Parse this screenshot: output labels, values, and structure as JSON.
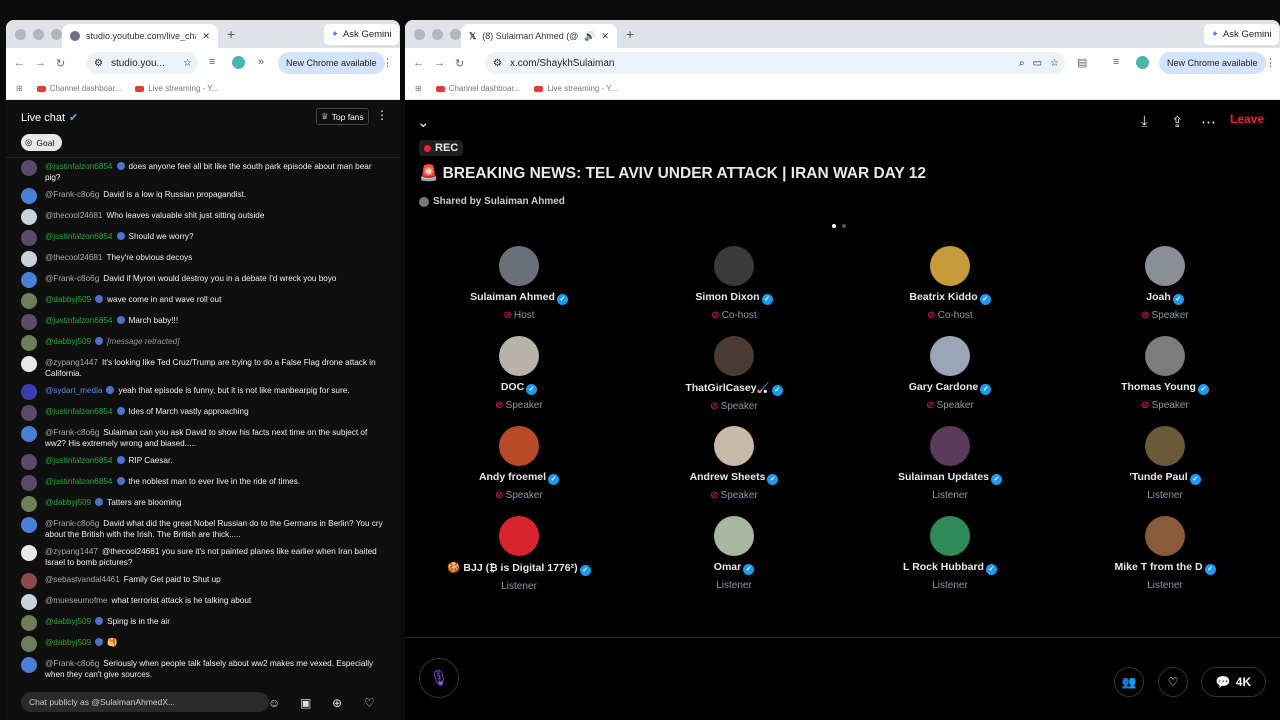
{
  "left_window": {
    "tab_title": "studio.youtube.com/live_cha",
    "ask_gemini": "Ask Gemini",
    "url": "studio.you...",
    "new_chrome": "New Chrome available",
    "bookmarks": [
      "Channel dashboar...",
      "Live streaming - Y..."
    ],
    "chat": {
      "title": "Live chat",
      "top_fans": "Top fans",
      "goal": "Goal",
      "input_placeholder": "Chat publicly as @SulaimanAhmedX...",
      "messages": [
        {
          "user": "@justinfalzon6854",
          "text": "does anyone feel all bit like the south park episode about man bear pig?",
          "color": "green",
          "avatar": "#5a4b6b"
        },
        {
          "user": "@Frank-c8o6g",
          "text": "David is a low iq Russian propagandist.",
          "color": "grey",
          "avatar": "#4a7fd6"
        },
        {
          "user": "@thecool24681",
          "text": "Who leaves valuable shit just sitting outside",
          "color": "grey",
          "avatar": "#c9d3de"
        },
        {
          "user": "@justinfalzon6854",
          "text": "Should we worry?",
          "color": "green",
          "avatar": "#5a4b6b"
        },
        {
          "user": "@thecool24681",
          "text": "They're obvious decoys",
          "color": "grey",
          "avatar": "#c9d3de"
        },
        {
          "user": "@Frank-c8o6g",
          "text": "David if Myron would destroy you in a debate I'd wreck you boyo",
          "color": "grey",
          "avatar": "#4a7fd6"
        },
        {
          "user": "@dabbyj509",
          "text": "wave come in and wave roll out",
          "color": "green",
          "avatar": "#6d7f5a"
        },
        {
          "user": "@justinfalzon6854",
          "text": "March baby!!!",
          "color": "green",
          "avatar": "#5a4b6b"
        },
        {
          "user": "@dabbyj509",
          "text": "[message retracted]",
          "color": "green",
          "avatar": "#6d7f5a",
          "retracted": true
        },
        {
          "user": "@zypang1447",
          "text": "It's looking like Ted Cruz/Trump are trying to do a False Flag drone attack in California.",
          "color": "grey",
          "avatar": "#e8e8e8"
        },
        {
          "user": "@sydart_media",
          "text": "yeah that episode is funny, but it is not like manbearpig for sure.",
          "color": "blue",
          "avatar": "#3b3fb0"
        },
        {
          "user": "@justinfalzon6854",
          "text": "Ides of March vastly approaching",
          "color": "green",
          "avatar": "#5a4b6b"
        },
        {
          "user": "@Frank-c8o6g",
          "text": "Sulaiman can you ask David to show his facts next time on the subject of ww2? His extremely wrong and biased.....",
          "color": "grey",
          "avatar": "#4a7fd6"
        },
        {
          "user": "@justinfalzon6854",
          "text": "RIP Caesar.",
          "color": "green",
          "avatar": "#5a4b6b"
        },
        {
          "user": "@justinfalzon6854",
          "text": "the noblest man to ever live in the ride of times.",
          "color": "green",
          "avatar": "#5a4b6b"
        },
        {
          "user": "@dabbyj509",
          "text": "Tatters are blooming",
          "color": "green",
          "avatar": "#6d7f5a"
        },
        {
          "user": "@Frank-c8o6g",
          "text": "David what did the great Nobel Russian do to the Germans in Berlin? You cry about the British with the Irish. The British are thick.....",
          "color": "grey",
          "avatar": "#4a7fd6"
        },
        {
          "user": "@zypang1447",
          "text": "@thecool24681 you sure it's not painted planes like earlier when Iran baited Israel to bomb pictures?",
          "color": "grey",
          "avatar": "#e8e8e8"
        },
        {
          "user": "@sebastvandal4461",
          "text": "Family Get paid to Shut up",
          "color": "grey",
          "avatar": "#8a4a4a"
        },
        {
          "user": "@mueseumofme",
          "text": "what terrorist attack is he talking about",
          "color": "grey",
          "avatar": "#c9d3de"
        },
        {
          "user": "@dabbyj509",
          "text": "Sping is in the air",
          "color": "green",
          "avatar": "#6d7f5a"
        },
        {
          "user": "@dabbyj509",
          "text": "🥞",
          "color": "green",
          "avatar": "#6d7f5a"
        },
        {
          "user": "@Frank-c8o6g",
          "text": "Seriously when people talk falsely about ww2 makes me vexed. Especially when they can't give sources.",
          "color": "grey",
          "avatar": "#4a7fd6"
        }
      ]
    }
  },
  "right_window": {
    "tab_title": "(8) Sulaiman Ahmed (@Sh",
    "ask_gemini": "Ask Gemini",
    "url": "x.com/ShaykhSulaiman",
    "new_chrome": "New Chrome available",
    "bookmarks": [
      "Channel dashboar...",
      "Live streaming - Y..."
    ],
    "space": {
      "leave": "Leave",
      "rec": "REC",
      "title": "🚨 BREAKING NEWS: TEL AVIV UNDER ATTACK | IRAN WAR DAY 12",
      "shared_by": "Shared by Sulaiman Ahmed",
      "listener_count": "4K",
      "participants": [
        {
          "name": "Sulaiman Ahmed",
          "role": "Host",
          "verified": true,
          "mic": true,
          "avatar": "#6b6f7a"
        },
        {
          "name": "Simon Dixon",
          "role": "Co-host",
          "verified": true,
          "mic": true,
          "avatar": "#3a3a3a"
        },
        {
          "name": "Beatrix Kiddo",
          "role": "Co-host",
          "verified": true,
          "mic": true,
          "avatar": "#c79a3a"
        },
        {
          "name": "Joah",
          "role": "Speaker",
          "verified": true,
          "mic": true,
          "avatar": "#8a8f96"
        },
        {
          "name": "DOC",
          "role": "Speaker",
          "verified": true,
          "mic": true,
          "avatar": "#b8b2a8"
        },
        {
          "name": "ThatGirlCasey🏑",
          "role": "Speaker",
          "verified": true,
          "mic": true,
          "avatar": "#4a3a33"
        },
        {
          "name": "Gary Cardone",
          "role": "Speaker",
          "verified": true,
          "mic": true,
          "avatar": "#9aa6b8"
        },
        {
          "name": "Thomas Young",
          "role": "Speaker",
          "verified": true,
          "mic": true,
          "avatar": "#7c7c7c"
        },
        {
          "name": "Andy froemel",
          "role": "Speaker",
          "verified": true,
          "mic": true,
          "avatar": "#b84a2a"
        },
        {
          "name": "Andrew Sheets",
          "role": "Speaker",
          "verified": true,
          "mic": true,
          "avatar": "#c9b9a8"
        },
        {
          "name": "Sulaiman Updates",
          "role": "Listener",
          "verified": true,
          "mic": false,
          "avatar": "#5a3a5a"
        },
        {
          "name": "'Tunde Paul",
          "role": "Listener",
          "verified": true,
          "mic": false,
          "avatar": "#6a5a3a"
        },
        {
          "name": "🍪 BJJ (₿ is Digital 1776²)",
          "role": "Listener",
          "verified": true,
          "mic": false,
          "avatar": "#d8252e"
        },
        {
          "name": "Omar",
          "role": "Listener",
          "verified": true,
          "mic": false,
          "avatar": "#a8b8a0"
        },
        {
          "name": "L Rock Hubbard",
          "role": "Listener",
          "verified": true,
          "mic": false,
          "avatar": "#2e8b57"
        },
        {
          "name": "Mike T from the D",
          "role": "Listener",
          "verified": true,
          "mic": false,
          "avatar": "#8a5a3a"
        }
      ]
    }
  }
}
